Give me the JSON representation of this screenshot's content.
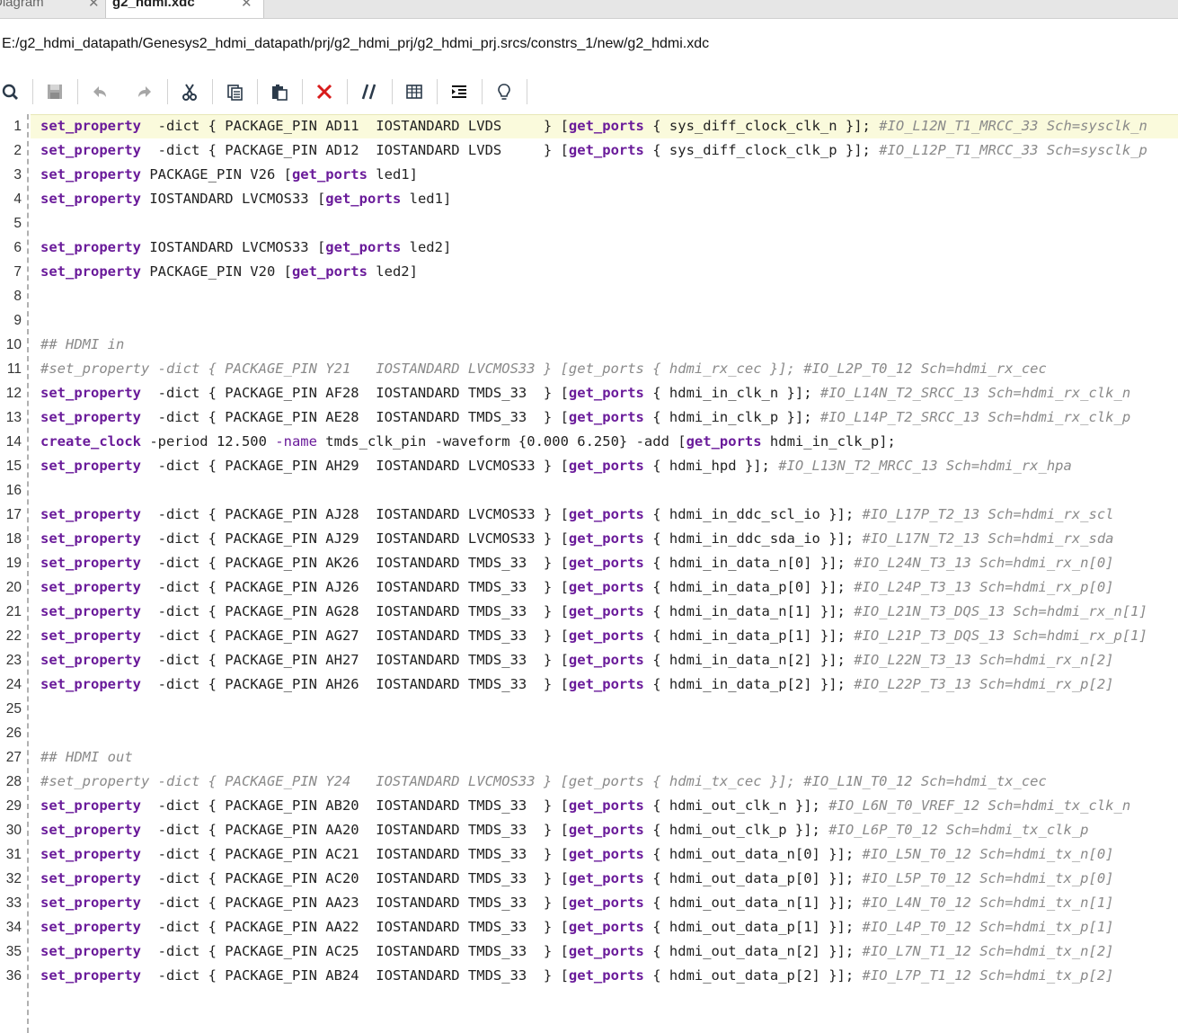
{
  "tabs": [
    {
      "label": "Diagram"
    },
    {
      "label": "g2_hdmi.xdc"
    }
  ],
  "file_path": "E:/g2_hdmi_datapath/Genesys2_hdmi_datapath/prj/g2_hdmi_prj/g2_hdmi_prj.srcs/constrs_1/new/g2_hdmi.xdc",
  "toolbar": [
    "search-icon",
    "save-icon",
    "undo-icon",
    "redo-icon",
    "cut-icon",
    "copy-icon",
    "paste-icon",
    "delete-icon",
    "comment-icon",
    "columns-icon",
    "indent-icon",
    "lightbulb-icon"
  ],
  "colors": {
    "keyword": "#6a1b9a",
    "comment": "#8a8a8a",
    "current_line": "#fafadc",
    "delete": "#d81b1b"
  },
  "lines": [
    {
      "n": "1",
      "segs": [
        [
          "kw",
          "set_property"
        ],
        [
          "",
          "  -dict { PACKAGE_PIN AD11  IOSTANDARD LVDS     } ["
        ],
        [
          "kw",
          "get_ports"
        ],
        [
          "",
          " { sys_diff_clock_clk_n }]; "
        ],
        [
          "cm",
          "#IO_L12N_T1_MRCC_33 Sch=sysclk_n"
        ]
      ]
    },
    {
      "n": "2",
      "segs": [
        [
          "kw",
          "set_property"
        ],
        [
          "",
          "  -dict { PACKAGE_PIN AD12  IOSTANDARD LVDS     } ["
        ],
        [
          "kw",
          "get_ports"
        ],
        [
          "",
          " { sys_diff_clock_clk_p }]; "
        ],
        [
          "cm",
          "#IO_L12P_T1_MRCC_33 Sch=sysclk_p"
        ]
      ]
    },
    {
      "n": "3",
      "segs": [
        [
          "kw",
          "set_property"
        ],
        [
          "",
          " PACKAGE_PIN V26 ["
        ],
        [
          "kw",
          "get_ports"
        ],
        [
          "",
          " led1]"
        ]
      ]
    },
    {
      "n": "4",
      "segs": [
        [
          "kw",
          "set_property"
        ],
        [
          "",
          " IOSTANDARD LVCMOS33 ["
        ],
        [
          "kw",
          "get_ports"
        ],
        [
          "",
          " led1]"
        ]
      ]
    },
    {
      "n": "5",
      "segs": []
    },
    {
      "n": "6",
      "segs": [
        [
          "kw",
          "set_property"
        ],
        [
          "",
          " IOSTANDARD LVCMOS33 ["
        ],
        [
          "kw",
          "get_ports"
        ],
        [
          "",
          " led2]"
        ]
      ]
    },
    {
      "n": "7",
      "segs": [
        [
          "kw",
          "set_property"
        ],
        [
          "",
          " PACKAGE_PIN V20 ["
        ],
        [
          "kw",
          "get_ports"
        ],
        [
          "",
          " led2]"
        ]
      ]
    },
    {
      "n": "8",
      "segs": []
    },
    {
      "n": "9",
      "segs": []
    },
    {
      "n": "10",
      "segs": [
        [
          "cm",
          "## HDMI in"
        ]
      ]
    },
    {
      "n": "11",
      "segs": [
        [
          "cm",
          "#set_property -dict { PACKAGE_PIN Y21   IOSTANDARD LVCMOS33 } [get_ports { hdmi_rx_cec }]; #IO_L2P_T0_12 Sch=hdmi_rx_cec"
        ]
      ]
    },
    {
      "n": "12",
      "segs": [
        [
          "kw",
          "set_property"
        ],
        [
          "",
          "  -dict { PACKAGE_PIN AF28  IOSTANDARD TMDS_33  } ["
        ],
        [
          "kw",
          "get_ports"
        ],
        [
          "",
          " { hdmi_in_clk_n }]; "
        ],
        [
          "cm",
          "#IO_L14N_T2_SRCC_13 Sch=hdmi_rx_clk_n"
        ]
      ]
    },
    {
      "n": "13",
      "segs": [
        [
          "kw",
          "set_property"
        ],
        [
          "",
          "  -dict { PACKAGE_PIN AE28  IOSTANDARD TMDS_33  } ["
        ],
        [
          "kw",
          "get_ports"
        ],
        [
          "",
          " { hdmi_in_clk_p }]; "
        ],
        [
          "cm",
          "#IO_L14P_T2_SRCC_13 Sch=hdmi_rx_clk_p"
        ]
      ]
    },
    {
      "n": "14",
      "segs": [
        [
          "kw",
          "create_clock"
        ],
        [
          "",
          " -period 12.500 "
        ],
        [
          "kw2",
          "-name"
        ],
        [
          "",
          " tmds_clk_pin -waveform {0.000 6.250} -add ["
        ],
        [
          "kw",
          "get_ports"
        ],
        [
          "",
          " hdmi_in_clk_p];"
        ]
      ]
    },
    {
      "n": "15",
      "segs": [
        [
          "kw",
          "set_property"
        ],
        [
          "",
          "  -dict { PACKAGE_PIN AH29  IOSTANDARD LVCMOS33 } ["
        ],
        [
          "kw",
          "get_ports"
        ],
        [
          "",
          " { hdmi_hpd }]; "
        ],
        [
          "cm",
          "#IO_L13N_T2_MRCC_13 Sch=hdmi_rx_hpa"
        ]
      ]
    },
    {
      "n": "16",
      "segs": []
    },
    {
      "n": "17",
      "segs": [
        [
          "kw",
          "set_property"
        ],
        [
          "",
          "  -dict { PACKAGE_PIN AJ28  IOSTANDARD LVCMOS33 } ["
        ],
        [
          "kw",
          "get_ports"
        ],
        [
          "",
          " { hdmi_in_ddc_scl_io }]; "
        ],
        [
          "cm",
          "#IO_L17P_T2_13 Sch=hdmi_rx_scl"
        ]
      ]
    },
    {
      "n": "18",
      "segs": [
        [
          "kw",
          "set_property"
        ],
        [
          "",
          "  -dict { PACKAGE_PIN AJ29  IOSTANDARD LVCMOS33 } ["
        ],
        [
          "kw",
          "get_ports"
        ],
        [
          "",
          " { hdmi_in_ddc_sda_io }]; "
        ],
        [
          "cm",
          "#IO_L17N_T2_13 Sch=hdmi_rx_sda"
        ]
      ]
    },
    {
      "n": "19",
      "segs": [
        [
          "kw",
          "set_property"
        ],
        [
          "",
          "  -dict { PACKAGE_PIN AK26  IOSTANDARD TMDS_33  } ["
        ],
        [
          "kw",
          "get_ports"
        ],
        [
          "",
          " { hdmi_in_data_n[0] }]; "
        ],
        [
          "cm",
          "#IO_L24N_T3_13 Sch=hdmi_rx_n[0]"
        ]
      ]
    },
    {
      "n": "20",
      "segs": [
        [
          "kw",
          "set_property"
        ],
        [
          "",
          "  -dict { PACKAGE_PIN AJ26  IOSTANDARD TMDS_33  } ["
        ],
        [
          "kw",
          "get_ports"
        ],
        [
          "",
          " { hdmi_in_data_p[0] }]; "
        ],
        [
          "cm",
          "#IO_L24P_T3_13 Sch=hdmi_rx_p[0]"
        ]
      ]
    },
    {
      "n": "21",
      "segs": [
        [
          "kw",
          "set_property"
        ],
        [
          "",
          "  -dict { PACKAGE_PIN AG28  IOSTANDARD TMDS_33  } ["
        ],
        [
          "kw",
          "get_ports"
        ],
        [
          "",
          " { hdmi_in_data_n[1] }]; "
        ],
        [
          "cm",
          "#IO_L21N_T3_DQS_13 Sch=hdmi_rx_n[1]"
        ]
      ]
    },
    {
      "n": "22",
      "segs": [
        [
          "kw",
          "set_property"
        ],
        [
          "",
          "  -dict { PACKAGE_PIN AG27  IOSTANDARD TMDS_33  } ["
        ],
        [
          "kw",
          "get_ports"
        ],
        [
          "",
          " { hdmi_in_data_p[1] }]; "
        ],
        [
          "cm",
          "#IO_L21P_T3_DQS_13 Sch=hdmi_rx_p[1]"
        ]
      ]
    },
    {
      "n": "23",
      "segs": [
        [
          "kw",
          "set_property"
        ],
        [
          "",
          "  -dict { PACKAGE_PIN AH27  IOSTANDARD TMDS_33  } ["
        ],
        [
          "kw",
          "get_ports"
        ],
        [
          "",
          " { hdmi_in_data_n[2] }]; "
        ],
        [
          "cm",
          "#IO_L22N_T3_13 Sch=hdmi_rx_n[2]"
        ]
      ]
    },
    {
      "n": "24",
      "segs": [
        [
          "kw",
          "set_property"
        ],
        [
          "",
          "  -dict { PACKAGE_PIN AH26  IOSTANDARD TMDS_33  } ["
        ],
        [
          "kw",
          "get_ports"
        ],
        [
          "",
          " { hdmi_in_data_p[2] }]; "
        ],
        [
          "cm",
          "#IO_L22P_T3_13 Sch=hdmi_rx_p[2]"
        ]
      ]
    },
    {
      "n": "25",
      "segs": []
    },
    {
      "n": "26",
      "segs": []
    },
    {
      "n": "27",
      "segs": [
        [
          "cm",
          "## HDMI out"
        ]
      ]
    },
    {
      "n": "28",
      "segs": [
        [
          "cm",
          "#set_property -dict { PACKAGE_PIN Y24   IOSTANDARD LVCMOS33 } [get_ports { hdmi_tx_cec }]; #IO_L1N_T0_12 Sch=hdmi_tx_cec"
        ]
      ]
    },
    {
      "n": "29",
      "segs": [
        [
          "kw",
          "set_property"
        ],
        [
          "",
          "  -dict { PACKAGE_PIN AB20  IOSTANDARD TMDS_33  } ["
        ],
        [
          "kw",
          "get_ports"
        ],
        [
          "",
          " { hdmi_out_clk_n }]; "
        ],
        [
          "cm",
          "#IO_L6N_T0_VREF_12 Sch=hdmi_tx_clk_n"
        ]
      ]
    },
    {
      "n": "30",
      "segs": [
        [
          "kw",
          "set_property"
        ],
        [
          "",
          "  -dict { PACKAGE_PIN AA20  IOSTANDARD TMDS_33  } ["
        ],
        [
          "kw",
          "get_ports"
        ],
        [
          "",
          " { hdmi_out_clk_p }]; "
        ],
        [
          "cm",
          "#IO_L6P_T0_12 Sch=hdmi_tx_clk_p"
        ]
      ]
    },
    {
      "n": "31",
      "segs": [
        [
          "kw",
          "set_property"
        ],
        [
          "",
          "  -dict { PACKAGE_PIN AC21  IOSTANDARD TMDS_33  } ["
        ],
        [
          "kw",
          "get_ports"
        ],
        [
          "",
          " { hdmi_out_data_n[0] }]; "
        ],
        [
          "cm",
          "#IO_L5N_T0_12 Sch=hdmi_tx_n[0]"
        ]
      ]
    },
    {
      "n": "32",
      "segs": [
        [
          "kw",
          "set_property"
        ],
        [
          "",
          "  -dict { PACKAGE_PIN AC20  IOSTANDARD TMDS_33  } ["
        ],
        [
          "kw",
          "get_ports"
        ],
        [
          "",
          " { hdmi_out_data_p[0] }]; "
        ],
        [
          "cm",
          "#IO_L5P_T0_12 Sch=hdmi_tx_p[0]"
        ]
      ]
    },
    {
      "n": "33",
      "segs": [
        [
          "kw",
          "set_property"
        ],
        [
          "",
          "  -dict { PACKAGE_PIN AA23  IOSTANDARD TMDS_33  } ["
        ],
        [
          "kw",
          "get_ports"
        ],
        [
          "",
          " { hdmi_out_data_n[1] }]; "
        ],
        [
          "cm",
          "#IO_L4N_T0_12 Sch=hdmi_tx_n[1]"
        ]
      ]
    },
    {
      "n": "34",
      "segs": [
        [
          "kw",
          "set_property"
        ],
        [
          "",
          "  -dict { PACKAGE_PIN AA22  IOSTANDARD TMDS_33  } ["
        ],
        [
          "kw",
          "get_ports"
        ],
        [
          "",
          " { hdmi_out_data_p[1] }]; "
        ],
        [
          "cm",
          "#IO_L4P_T0_12 Sch=hdmi_tx_p[1]"
        ]
      ]
    },
    {
      "n": "35",
      "segs": [
        [
          "kw",
          "set_property"
        ],
        [
          "",
          "  -dict { PACKAGE_PIN AC25  IOSTANDARD TMDS_33  } ["
        ],
        [
          "kw",
          "get_ports"
        ],
        [
          "",
          " { hdmi_out_data_n[2] }]; "
        ],
        [
          "cm",
          "#IO_L7N_T1_12 Sch=hdmi_tx_n[2]"
        ]
      ]
    },
    {
      "n": "36",
      "segs": [
        [
          "kw",
          "set_property"
        ],
        [
          "",
          "  -dict { PACKAGE_PIN AB24  IOSTANDARD TMDS_33  } ["
        ],
        [
          "kw",
          "get_ports"
        ],
        [
          "",
          " { hdmi_out_data_p[2] }]; "
        ],
        [
          "cm",
          "#IO_L7P_T1_12 Sch=hdmi_tx_p[2]"
        ]
      ]
    }
  ]
}
